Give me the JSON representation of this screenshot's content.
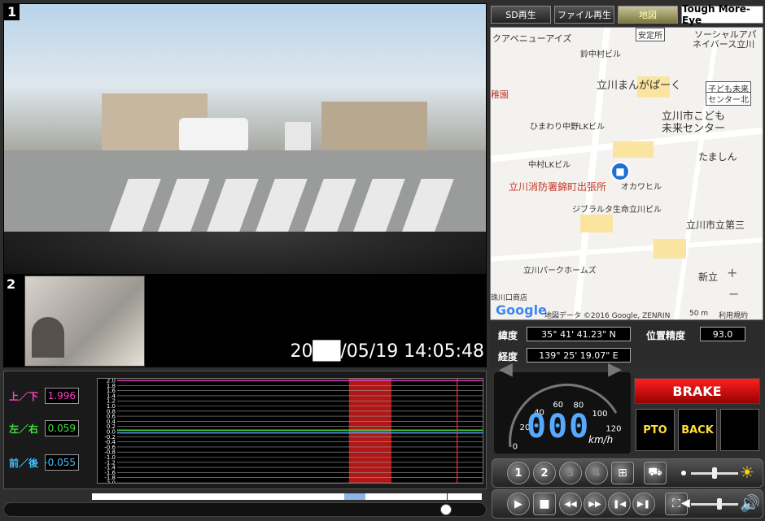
{
  "cam1": {
    "label": "1"
  },
  "cam2": {
    "label": "2"
  },
  "timestamp": "20██/05/19 14:05:48",
  "tabs": [
    {
      "label": "SD再生"
    },
    {
      "label": "ファイル再生"
    },
    {
      "label": "地図"
    },
    {
      "label": "Tough More-Eye"
    }
  ],
  "map": {
    "labels": [
      "クアベニューアイズ",
      "安定所",
      "ソーシャルアパ",
      "ネイバース立川",
      "鈴中村ビル",
      "立川まんがぱーく",
      "子ども未来",
      "センター北",
      "稚園",
      "立川市こども",
      "未来センター",
      "ひまわり中野LKビル",
      "たましん",
      "中村LKビル",
      "立川消防署錦町出張所",
      "オカワヒル",
      "ジブラルタ生命立川ビル",
      "立川市立第三",
      "立川パークホームズ",
      "新立",
      "珠川口商店"
    ],
    "google": "Google",
    "attribution": "地図データ ©2016 Google, ZENRIN",
    "scale": "50 m",
    "terms": "利用規約",
    "zoom_in": "+",
    "zoom_out": "−"
  },
  "gps": {
    "lat_label": "緯度",
    "lat_value": "35° 41' 41.23\" N",
    "lon_label": "経度",
    "lon_value": "139° 25' 19.07\" E",
    "acc_label": "位置精度",
    "acc_value": "93.0"
  },
  "sensors": {
    "updown_label": "上／下",
    "updown_value": "1.996",
    "leftright_label": "左／右",
    "leftright_value": "0.059",
    "frontback_label": "前／後",
    "frontback_value": "-0.055"
  },
  "chart_data": {
    "type": "line",
    "ylim": [
      -2.0,
      2.0
    ],
    "yticks": [
      "2.0",
      "1.8",
      "1.6",
      "1.4",
      "1.2",
      "1.0",
      "0.8",
      "0.6",
      "0.4",
      "0.2",
      "0.0",
      "-0.2",
      "-0.4",
      "-0.6",
      "-0.8",
      "-1.0",
      "-1.2",
      "-1.4",
      "-1.6",
      "-1.8",
      "-2.0"
    ],
    "series": [
      {
        "color": "#e040c0",
        "value": 1.996
      },
      {
        "color": "#40e040",
        "value": 0.059
      },
      {
        "color": "#40a0ff",
        "value": -0.055
      }
    ],
    "highlight_range": [
      0.65,
      0.76
    ],
    "cursor": 0.93
  },
  "speedometer": {
    "ticks": [
      "0",
      "20",
      "40",
      "60",
      "80",
      "100",
      "120"
    ],
    "value": "000",
    "unit": "km/h"
  },
  "status": {
    "brake": "BRAKE",
    "pto": "PTO",
    "back": "BACK"
  },
  "cam_buttons": [
    "1",
    "2",
    "3",
    "4"
  ],
  "colors": {
    "brake": "#e01010",
    "accent": "#ffe033",
    "highlight": "#b01818"
  }
}
